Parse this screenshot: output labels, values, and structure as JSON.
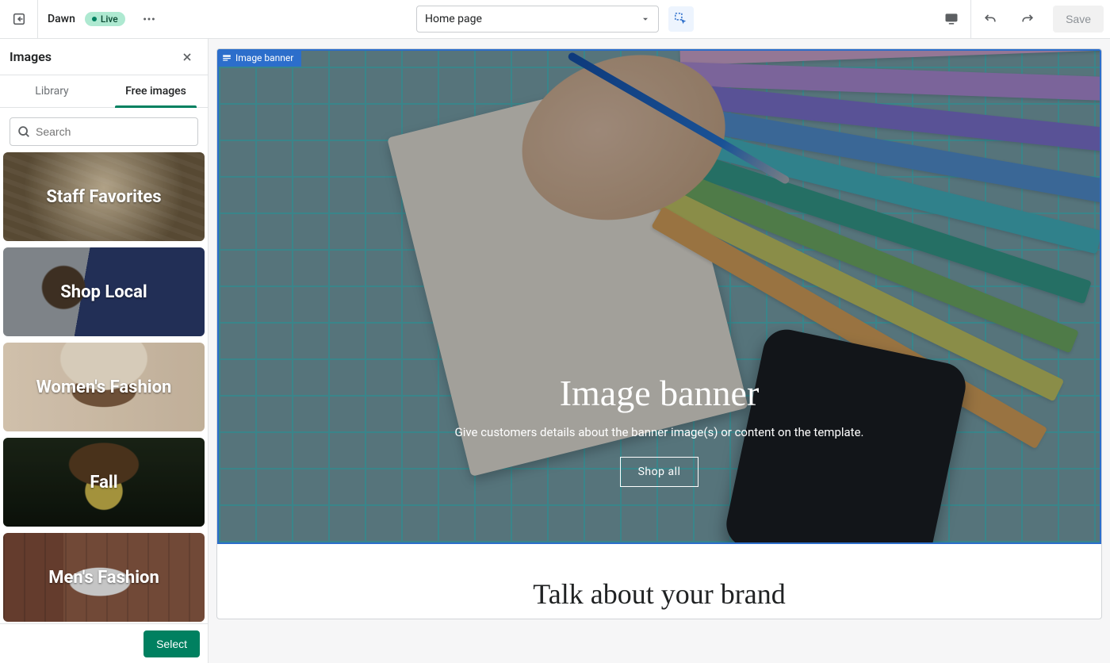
{
  "topbar": {
    "theme_name": "Dawn",
    "live_badge": "Live",
    "page_select_value": "Home page",
    "save_label": "Save"
  },
  "sidebar": {
    "title": "Images",
    "tabs": {
      "library": "Library",
      "free": "Free images"
    },
    "search_placeholder": "Search",
    "select_label": "Select",
    "categories": [
      {
        "label": "Staff Favorites"
      },
      {
        "label": "Shop Local"
      },
      {
        "label": "Women's Fashion"
      },
      {
        "label": "Fall"
      },
      {
        "label": "Men's Fashion"
      }
    ]
  },
  "canvas": {
    "section_chip": "Image banner",
    "banner": {
      "heading": "Image banner",
      "subheading": "Give customers details about the banner image(s) or content on the template.",
      "button": "Shop all"
    },
    "talk_section": {
      "heading": "Talk about your brand"
    }
  },
  "colors": {
    "primary": "#008060",
    "selection": "#2c6ecb"
  }
}
